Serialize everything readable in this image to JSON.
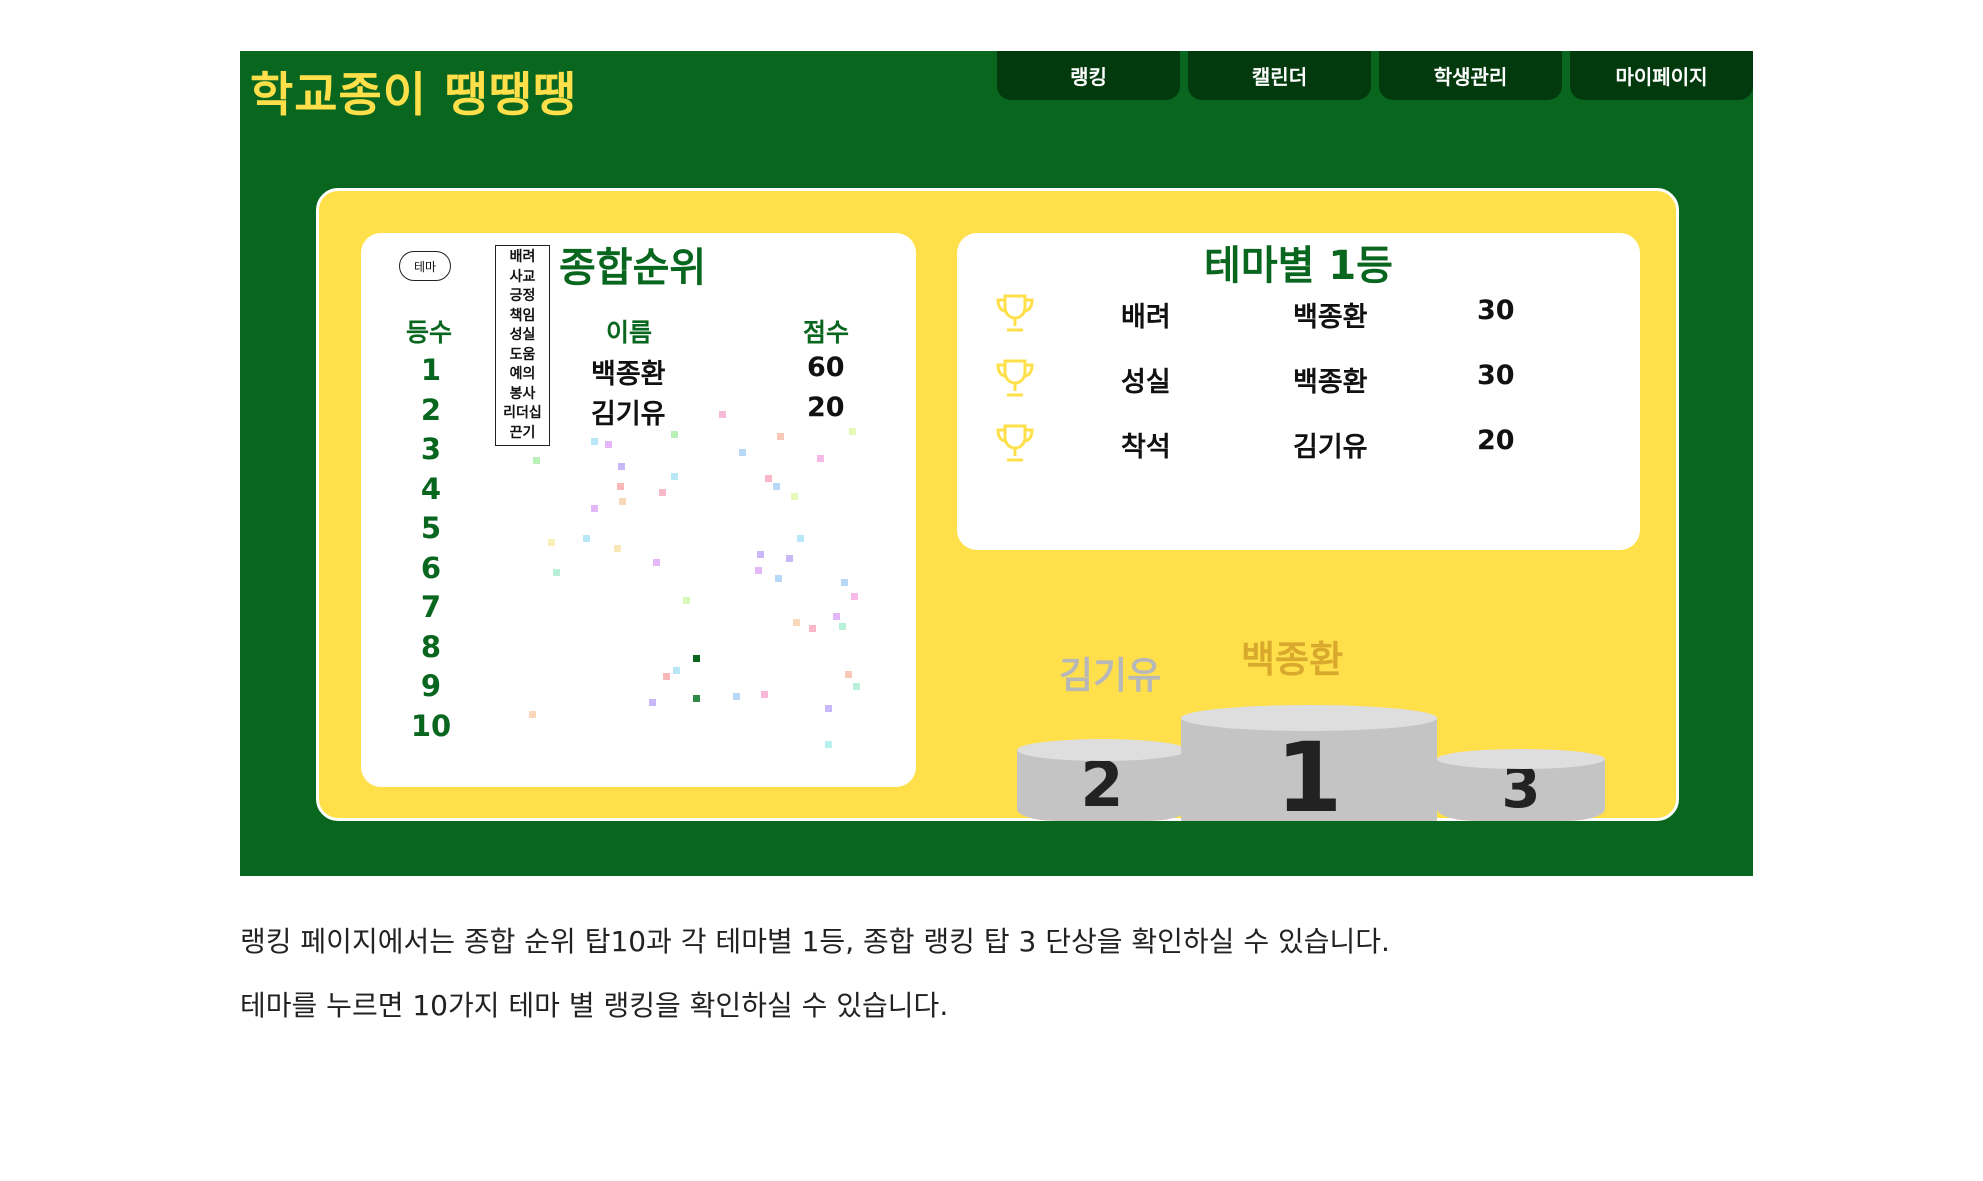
{
  "header": {
    "logo": "학교종이 땡땡땡",
    "nav": [
      "랭킹",
      "캘린더",
      "학생관리",
      "마이페이지"
    ]
  },
  "overall": {
    "title": "종합순위",
    "theme_button": "테마",
    "col_rank": "등수",
    "col_name": "이름",
    "col_score": "점수",
    "ranks": [
      "1",
      "2",
      "3",
      "4",
      "5",
      "6",
      "7",
      "8",
      "9",
      "10"
    ],
    "rows": [
      {
        "name": "백종환",
        "score": "60"
      },
      {
        "name": "김기유",
        "score": "20"
      }
    ]
  },
  "theme_dropdown": [
    "배려",
    "사교",
    "긍정",
    "책임",
    "성실",
    "도움",
    "예의",
    "봉사",
    "리더십",
    "끈기"
  ],
  "theme_winners": {
    "title": "테마별 1등",
    "rows": [
      {
        "theme": "배려",
        "name": "백종환",
        "score": "30"
      },
      {
        "theme": "성실",
        "name": "백종환",
        "score": "30"
      },
      {
        "theme": "착석",
        "name": "김기유",
        "score": "20"
      }
    ]
  },
  "podium": {
    "first_name": "백종환",
    "second_name": "김기유",
    "labels": [
      "2",
      "1",
      "3"
    ]
  },
  "captions": [
    "랭킹 페이지에서는  종합 순위 탑10과 각 테마별 1등, 종합 랭킹 탑 3 단상을 확인하실 수 있습니다.",
    "테마를 누르면 10가지 테마 별 랭킹을 확인하실 수 있습니다."
  ],
  "colors": {
    "background_green": "#08661e",
    "nav_dark": "#023a0d",
    "accent_yellow": "#ffe04a",
    "gold_text": "#d9a92e",
    "silver_text": "#b8b8b8"
  }
}
